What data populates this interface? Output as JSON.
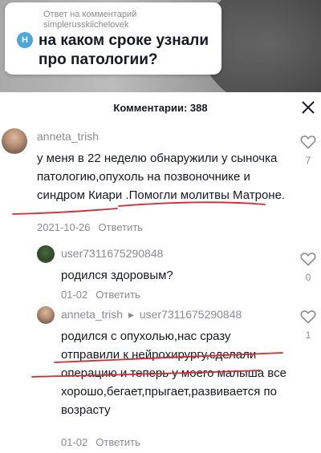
{
  "sticker": {
    "reply_label": "Ответ на комментарий",
    "reply_user": "simplerusskiichelovek",
    "avatar_letter": "H",
    "question": "на каком сроке узнали про патологии?"
  },
  "sheet": {
    "title": "Комментарии: 388"
  },
  "comments": [
    {
      "username": "anneta_trish",
      "text": "у меня в 22 неделю обнаружили у сыночка патологию,опухоль на позвоночнике и синдром Киари .Помогли молитвы Матроне.",
      "date": "2021-10-26",
      "reply_label": "Ответить",
      "likes": "7"
    },
    {
      "username": "user7311675290848",
      "text": "родился здоровым?",
      "date": "01-02",
      "reply_label": "Ответить",
      "likes": "0"
    },
    {
      "username": "anneta_trish",
      "reply_to": "user7311675290848",
      "reply_arrow": "▸",
      "text": "родился с опухолью,нас сразу отправили к нейрохирургу,сделали операцию и теперь у моего малыша все хорошо,бегает,прыгает,развивается по возрасту",
      "date": "01-02",
      "reply_label": "Ответить",
      "likes": "1"
    }
  ],
  "colors": {
    "underline_marker": "#e0252b",
    "muted_text": "#8a8b91"
  },
  "icons": {
    "close": "close-icon",
    "like": "heart-outline-icon"
  }
}
